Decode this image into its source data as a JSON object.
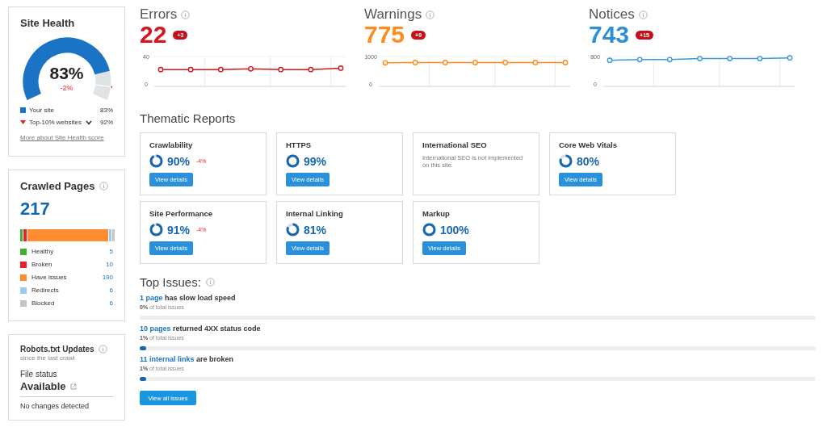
{
  "site_health": {
    "title": "Site Health",
    "value": "83%",
    "change": "-2%",
    "legend": [
      {
        "kind": "square",
        "label": "Your site",
        "value": "83%",
        "color": "#1a73c5"
      },
      {
        "kind": "marker",
        "label": "Top-10% websites",
        "value": "92%",
        "color": "#e0202a"
      }
    ],
    "link": "More about Site Health score"
  },
  "crawled_pages": {
    "title": "Crawled Pages",
    "total": "217",
    "items": [
      {
        "label": "Healthy",
        "count": "5",
        "color": "#3cb02c"
      },
      {
        "label": "Broken",
        "count": "10",
        "color": "#e5222c"
      },
      {
        "label": "Have issues",
        "count": "190",
        "color": "#ff8c2e"
      },
      {
        "label": "Redirects",
        "count": "6",
        "color": "#9dcaf0"
      },
      {
        "label": "Blocked",
        "count": "6",
        "color": "#c4c4c4"
      }
    ]
  },
  "robots": {
    "title": "Robots.txt Updates",
    "subtitle": "since the last crawl",
    "status_label": "File status",
    "status": "Available",
    "message": "No changes detected"
  },
  "metrics": [
    {
      "kind": "errors",
      "title": "Errors",
      "value": "22",
      "badge": "+3",
      "chart_data": {
        "type": "line",
        "ylim": [
          0,
          40
        ],
        "yticks": [
          0,
          40
        ],
        "series": [
          {
            "color": "#d5161e",
            "marker": "o",
            "values": [
              21,
              21,
              21,
              22,
              21,
              21,
              23
            ]
          }
        ]
      }
    },
    {
      "kind": "warnings",
      "title": "Warnings",
      "value": "775",
      "badge": "+9",
      "chart_data": {
        "type": "line",
        "ylim": [
          0,
          1000
        ],
        "yticks": [
          0,
          1000
        ],
        "series": [
          {
            "color": "#ff8c1a",
            "marker": "o",
            "values": [
              770,
              780,
              780,
              780,
              780,
              780,
              780
            ]
          }
        ]
      }
    },
    {
      "kind": "notices",
      "title": "Notices",
      "value": "743",
      "badge": "+15",
      "chart_data": {
        "type": "line",
        "ylim": [
          0,
          800
        ],
        "yticks": [
          0,
          800
        ],
        "series": [
          {
            "color": "#3a9bd8",
            "marker": "o",
            "values": [
              690,
              710,
              710,
              740,
              740,
              740,
              760
            ]
          }
        ]
      }
    }
  ],
  "thematic_reports": {
    "title": "Thematic Reports",
    "cards": [
      {
        "kind": "score",
        "title": "Crawlability",
        "value": "90%",
        "change": "-4%",
        "button": "View details"
      },
      {
        "kind": "score",
        "title": "HTTPS",
        "value": "99%",
        "button": "View details"
      },
      {
        "kind": "note",
        "title": "International SEO",
        "note": "International SEO is not implemented on this site."
      },
      {
        "kind": "score",
        "title": "Core Web Vitals",
        "value": "80%",
        "button": "View details"
      },
      {
        "kind": "score",
        "title": "Site Performance",
        "value": "91%",
        "change": "-4%",
        "button": "View details"
      },
      {
        "kind": "score",
        "title": "Internal Linking",
        "value": "81%",
        "button": "View details"
      },
      {
        "kind": "score",
        "title": "Markup",
        "value": "100%",
        "button": "View details"
      }
    ]
  },
  "top_issues": {
    "title": "Top Issues:",
    "issues": [
      {
        "link": "1 page",
        "text": "has slow load speed",
        "share": "**0%** of total issues",
        "level": 0
      },
      {
        "link": "10 pages",
        "text": "returned 4XX status code",
        "share": "**1%** of total issues",
        "level": 0.01
      },
      {
        "link": "11 internal links",
        "text": "are broken",
        "share": "**1%** of total issues",
        "level": 0.01
      }
    ],
    "button": "View all issues"
  }
}
